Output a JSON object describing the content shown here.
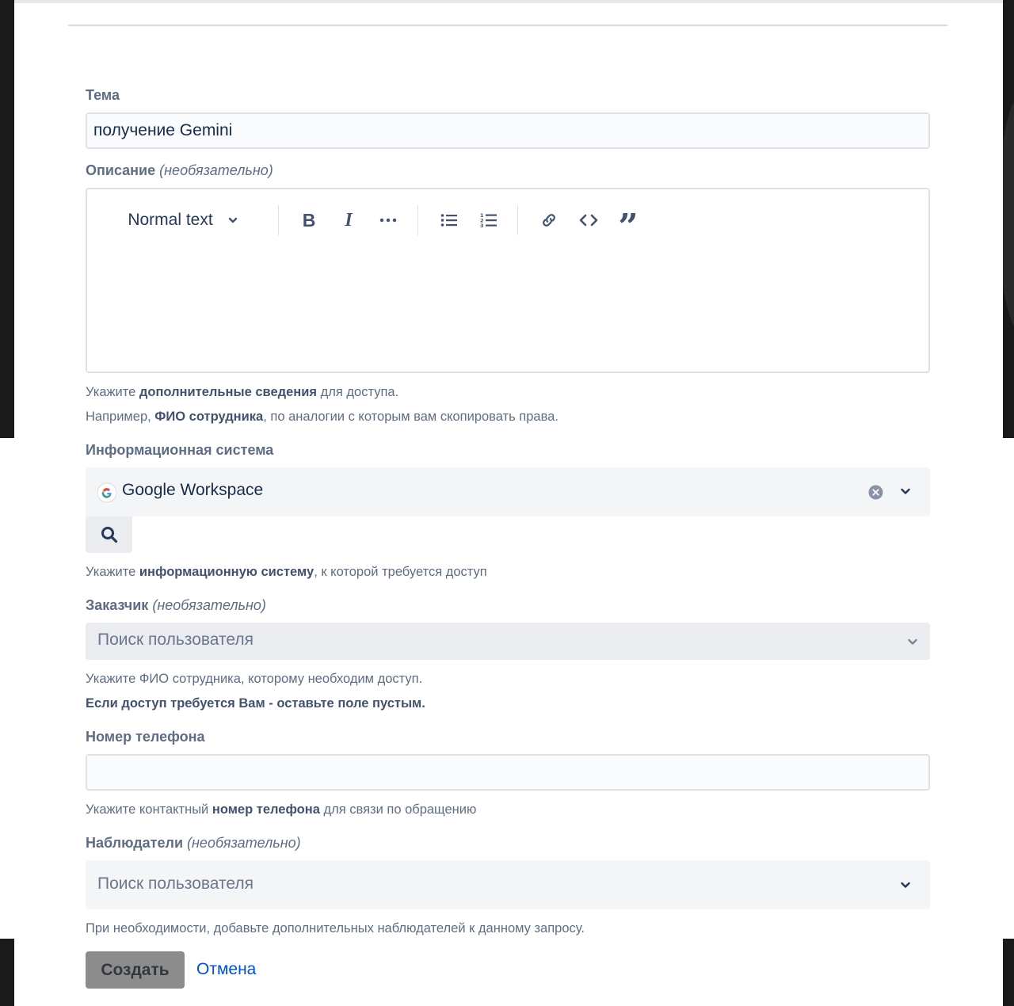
{
  "form": {
    "subject": {
      "label": "Тема",
      "value": "получение Gemini"
    },
    "description": {
      "label": "Описание",
      "optional": "(необязательно)",
      "toolbar": {
        "text_style": "Normal text"
      },
      "help_line1": {
        "t1": "Укажите ",
        "b1": "дополнительные сведения",
        "t2": " для доступа."
      },
      "help_line2": {
        "t1": "Например, ",
        "b1": "ФИО сотрудника",
        "t2": ", по аналогии с которым вам скопировать права."
      }
    },
    "system": {
      "label": "Информационная система",
      "value": "Google Workspace",
      "help": {
        "t1": "Укажите ",
        "b1": "информационную систему",
        "t2": ", к которой требуется доступ"
      }
    },
    "customer": {
      "label": "Заказчик",
      "optional": "(необязательно)",
      "placeholder": "Поиск пользователя",
      "help_line1": "Укажите ФИО сотрудника, которому необходим доступ.",
      "help_line2": "Если доступ требуется Вам - оставьте поле пустым."
    },
    "phone": {
      "label": "Номер телефона",
      "value": "",
      "help": {
        "t1": "Укажите контактный ",
        "b1": "номер телефона",
        "t2": " для связи по обращению"
      }
    },
    "watchers": {
      "label": "Наблюдатели",
      "optional": "(необязательно)",
      "placeholder": "Поиск пользователя",
      "help": "При необходимости, добавьте дополнительных наблюдателей к данному запросу."
    },
    "actions": {
      "create": "Создать",
      "cancel": "Отмена"
    }
  },
  "colors": {
    "accent_link": "#0052cc",
    "label_gray": "#5e6c84",
    "field_bg": "#f4f5f7",
    "create_button_bg": "#8c8c8c"
  },
  "icons": [
    "chevron-down-icon",
    "bold-icon",
    "italic-icon",
    "more-icon",
    "bullet-list-icon",
    "numbered-list-icon",
    "link-icon",
    "code-icon",
    "quote-icon",
    "google-icon",
    "clear-icon",
    "search-icon"
  ]
}
